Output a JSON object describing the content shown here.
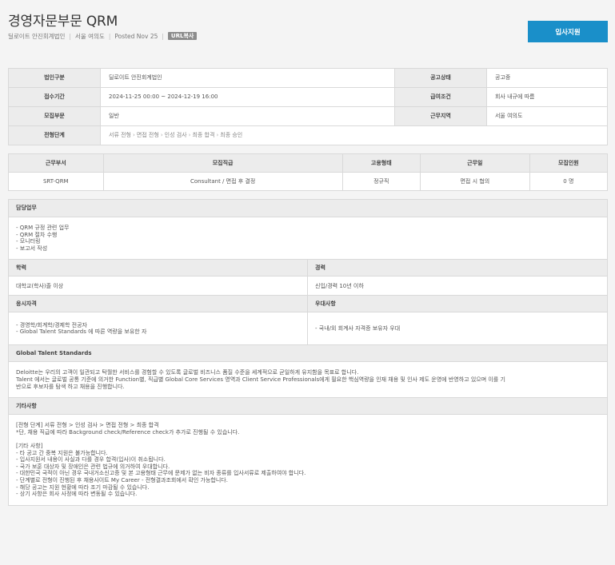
{
  "header": {
    "title": "경영자문부문 QRM",
    "company": "딜로이트 안진회계법인",
    "location": "서울 여의도",
    "posted": "Posted Nov 25",
    "url_badge": "URL복사",
    "apply_label": "입사지원"
  },
  "info": {
    "row1": {
      "label1": "법인구분",
      "value1": "딜로이트 안진회계법인",
      "label2": "공고상태",
      "value2": "공고중"
    },
    "row2": {
      "label1": "접수기간",
      "value1": "2024-11-25 00:00 ~ 2024-12-19 16:00",
      "label2": "급여조건",
      "value2": "회사 내규에 따름"
    },
    "row3": {
      "label1": "모집부문",
      "value1": "일반",
      "label2": "근무지역",
      "value2": "서울 여의도"
    },
    "row4": {
      "label1": "전형단계",
      "stages": [
        "서류 전형",
        "면접 전형",
        "인성 검사",
        "최종 합격",
        "최종 승인"
      ]
    },
    "stage_arrow": "›"
  },
  "dept": {
    "headers": [
      "근무부서",
      "모집직급",
      "고용형태",
      "근무일",
      "모집인원"
    ],
    "row": [
      "SRT-QRM",
      "Consultant / 면접 후 결정",
      "정규직",
      "면접 시 협의",
      "0 명"
    ]
  },
  "duty": {
    "title": "담당업무",
    "lines": [
      "- QRM 규정 관련 업무",
      "- QRM 절차 수행",
      "- 모니터링",
      "- 보고서 작성"
    ]
  },
  "education": {
    "title": "학력",
    "value": "대학교(학사)졸 이상"
  },
  "career": {
    "title": "경력",
    "value": "신입/경력  10년 이하"
  },
  "qualification": {
    "title": "응시자격",
    "lines": [
      "- 경영학/회계학/경제학 전공자",
      "- Global Talent Standards 에 따른 역량을 보유한 자"
    ]
  },
  "preference": {
    "title": "우대사항",
    "value": "- 국내/외 회계사 자격증 보유자 우대"
  },
  "gts": {
    "title": "Global Talent Standards",
    "lines": [
      "Deloitte는 우리의 고객이 일관되고 탁월한 서비스를 경험할 수 있도록 글로벌 비즈니스 품질 수준을 세계적으로 균일하게 유지함을 목표로 합니다.",
      "Talent 에서는 글로벌 공통 기준에 의거한 Function별, 직급별 Global Core Services 영역과 Client Service Professionals에게 필요한 핵심역량을 인재 채용 및 인사 제도 운영에 반영하고 있으며 이를 기",
      "반으로 후보자를 탐색 하고 채용을 진행합니다."
    ]
  },
  "etc": {
    "title": "기타사항",
    "lines": [
      "[전형 단계] 서류 전형 > 인성 검사 > 면접 전형 > 최종 합격",
      "*단, 채용 직급에 따라 Background check/Reference check가 추가로 진행될 수 있습니다.",
      "",
      "[기타 사항]",
      "- 타 공고 간 중복 지원은 불가능합니다.",
      "- 입사지원서 내용이 사실과 다를 경우 합격(입사)이 취소됩니다.",
      "- 국가 보훈 대상자 및 장애인은 관련 법규에 의거하여 우대합니다.",
      "- 대한민국 국적이 아닌 경우 국내거소신고증 및 본 고용형태 근무에 문제가 없는 비자 종류를 입사서류로 제출하여야 합니다.",
      "- 단계별로 전형이 진행된 후 채용사이트 My Career - 전형결과조회에서 확인 가능합니다.",
      "- 해당 공고는 지원 현황에 따라 조기 마감될 수 있습니다.",
      "- 상기 사항은 회사 사정에 따라 변동될 수 있습니다."
    ]
  },
  "colors": {
    "accent": "#1a8fc9",
    "header_bg": "#ececec",
    "border": "#d9d9d9",
    "badge": "#8c8c8c"
  }
}
